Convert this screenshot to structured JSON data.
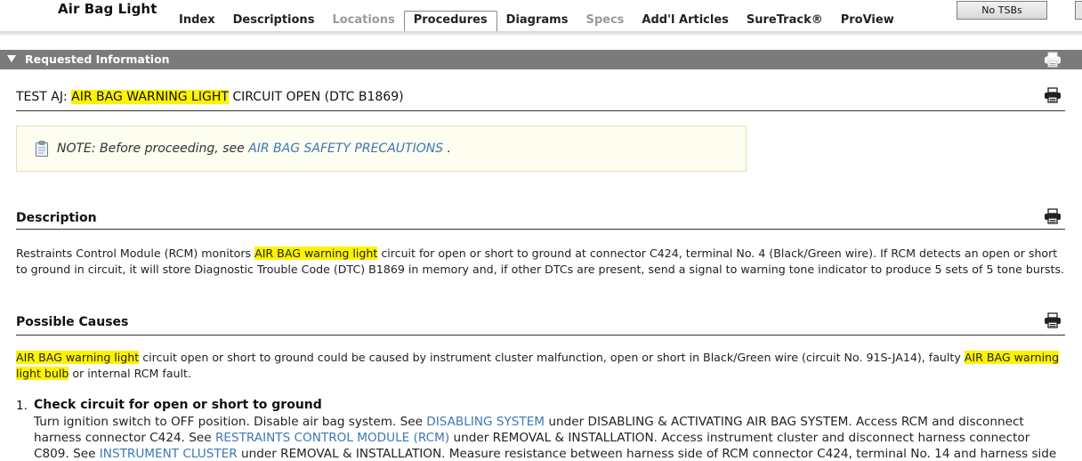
{
  "app": {
    "title": "Air Bag Light"
  },
  "tabs": [
    {
      "label": "Index",
      "state": "normal"
    },
    {
      "label": "Descriptions",
      "state": "normal"
    },
    {
      "label": "Locations",
      "state": "disabled"
    },
    {
      "label": "Procedures",
      "state": "active"
    },
    {
      "label": "Diagrams",
      "state": "normal"
    },
    {
      "label": "Specs",
      "state": "disabled"
    },
    {
      "label": "Add'l Articles",
      "state": "normal"
    },
    {
      "label": "SureTrack®",
      "state": "normal"
    },
    {
      "label": "ProView",
      "state": "normal"
    }
  ],
  "toolbar": {
    "tsb_label": "No TSBs"
  },
  "section": {
    "title": "Requested Information",
    "toggle_icon": "triangle-down-icon",
    "print_icon": "printer-icon"
  },
  "test": {
    "prefix": "TEST AJ: ",
    "highlight": "AIR BAG WARNING LIGHT",
    "suffix": " CIRCUIT OPEN (DTC B1869)"
  },
  "note": {
    "icon": "clipboard-note-icon",
    "prefix": "NOTE: Before proceeding, see ",
    "link": "AIR BAG SAFETY PRECAUTIONS",
    "suffix": " ."
  },
  "description": {
    "heading": "Description",
    "p1": "Restraints Control Module (RCM) monitors ",
    "hl1": "AIR BAG warning light",
    "p2": " circuit for open or short to ground at connector C424, terminal No. 4 (Black/Green wire). If RCM detects an open or short to ground in circuit, it will store Diagnostic Trouble Code (DTC) B1869 in memory and, if other DTCs are present, send a signal to warning tone indicator to produce 5 sets of 5 tone bursts."
  },
  "causes": {
    "heading": "Possible Causes",
    "hl1": "AIR BAG warning light",
    "p1": " circuit open or short to ground could be caused by instrument cluster malfunction, open or short in Black/Green wire (circuit No. 91S-JA14), faulty ",
    "hl2": "AIR BAG warning light bulb",
    "p2": " or internal RCM fault."
  },
  "steps": [
    {
      "number": "1.",
      "title": "Check circuit for open or short to ground",
      "t1": "Turn ignition switch to OFF position. Disable air bag system. See ",
      "link1": "DISABLING SYSTEM",
      "t2": "  under DISABLING & ACTIVATING AIR BAG SYSTEM. Access RCM and disconnect harness connector C424. See ",
      "link2": "RESTRAINTS CONTROL MODULE (RCM)",
      "t3": "  under REMOVAL & INSTALLATION. Access instrument cluster and disconnect harness connector C809. See ",
      "link3": "INSTRUMENT CLUSTER",
      "t4": "  under REMOVAL & INSTALLATION. Measure resistance between harness side of RCM connector C424, terminal No. 14 and harness side"
    }
  ]
}
